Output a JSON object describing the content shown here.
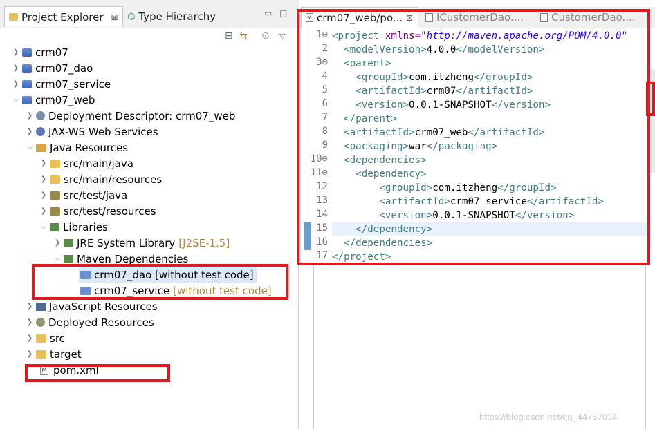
{
  "left_panel": {
    "tabs": [
      {
        "label": "Project Explorer",
        "close": "⊠"
      },
      {
        "label": "Type Hierarchy"
      }
    ],
    "window_controls": {
      "minimize": "▭",
      "maximize": "□"
    },
    "toolbar": {
      "collapse": "⊟",
      "link": "⇆",
      "filter": "⊙",
      "menu": "▽"
    }
  },
  "tree": [
    {
      "label": "crm07"
    },
    {
      "label": "crm07_dao"
    },
    {
      "label": "crm07_service"
    },
    {
      "label": "crm07_web"
    },
    {
      "label": "Deployment Descriptor: crm07_web"
    },
    {
      "label": "JAX-WS Web Services"
    },
    {
      "label": "Java Resources"
    },
    {
      "label": "src/main/java"
    },
    {
      "label": "src/main/resources"
    },
    {
      "label": "src/test/java"
    },
    {
      "label": "src/test/resources"
    },
    {
      "label": "Libraries"
    },
    {
      "label": "JRE System Library",
      "suffix": "[J2SE-1.5]"
    },
    {
      "label": "Maven Dependencies"
    },
    {
      "label": "crm07_dao [without test code]"
    },
    {
      "label": "crm07_service",
      "suffix": "[without test code]"
    },
    {
      "label": "JavaScript Resources"
    },
    {
      "label": "Deployed Resources"
    },
    {
      "label": "src"
    },
    {
      "label": "target"
    },
    {
      "label": "pom.xml",
      "icon_text": "M"
    }
  ],
  "editor": {
    "tabs": [
      {
        "label": "crm07_web/po...",
        "close": "⊠",
        "icon_text": "M"
      },
      {
        "label": "ICustomerDao...."
      },
      {
        "label": "CustomerDao...."
      }
    ],
    "line_numbers": [
      "1",
      "2",
      "3",
      "4",
      "5",
      "6",
      "7",
      "8",
      "9",
      "10",
      "11",
      "12",
      "13",
      "14",
      "15",
      "16",
      "17"
    ],
    "fold_markers": {
      "1": "⊖",
      "3": "⊖",
      "10": "⊖",
      "11": "⊖"
    },
    "lines": [
      [
        {
          "t": "<project ",
          "c": "tg"
        },
        {
          "t": "xmlns=",
          "c": "at"
        },
        {
          "t": "\"http://maven.apache.org/POM/4.0.0\"",
          "c": "av"
        }
      ],
      [
        {
          "t": "  <modelVersion>",
          "c": "tg"
        },
        {
          "t": "4.0.0",
          "c": "tx"
        },
        {
          "t": "</modelVersion>",
          "c": "tg"
        }
      ],
      [
        {
          "t": "  <parent>",
          "c": "tg"
        }
      ],
      [
        {
          "t": "    <groupId>",
          "c": "tg"
        },
        {
          "t": "com.itzheng",
          "c": "tx"
        },
        {
          "t": "</groupId>",
          "c": "tg"
        }
      ],
      [
        {
          "t": "    <artifactId>",
          "c": "tg"
        },
        {
          "t": "crm07",
          "c": "tx"
        },
        {
          "t": "</artifactId>",
          "c": "tg"
        }
      ],
      [
        {
          "t": "    <version>",
          "c": "tg"
        },
        {
          "t": "0.0.1-SNAPSHOT",
          "c": "tx"
        },
        {
          "t": "</version>",
          "c": "tg"
        }
      ],
      [
        {
          "t": "  </parent>",
          "c": "tg"
        }
      ],
      [
        {
          "t": "  <artifactId>",
          "c": "tg"
        },
        {
          "t": "crm07_web",
          "c": "tx"
        },
        {
          "t": "</artifactId>",
          "c": "tg"
        }
      ],
      [
        {
          "t": "  <packaging>",
          "c": "tg"
        },
        {
          "t": "war",
          "c": "tx"
        },
        {
          "t": "</packaging>",
          "c": "tg"
        }
      ],
      [
        {
          "t": "  <dependencies>",
          "c": "tg"
        }
      ],
      [
        {
          "t": "    <dependency>",
          "c": "tg"
        }
      ],
      [
        {
          "t": "        <groupId>",
          "c": "tg"
        },
        {
          "t": "com.itzheng",
          "c": "tx"
        },
        {
          "t": "</groupId>",
          "c": "tg"
        }
      ],
      [
        {
          "t": "        <artifactId>",
          "c": "tg"
        },
        {
          "t": "crm07_service",
          "c": "tx"
        },
        {
          "t": "</artifactId>",
          "c": "tg"
        }
      ],
      [
        {
          "t": "        <version>",
          "c": "tg"
        },
        {
          "t": "0.0.1-SNAPSHOT",
          "c": "tx"
        },
        {
          "t": "</version>",
          "c": "tg"
        }
      ],
      [
        {
          "t": "    </dependency>",
          "c": "tg"
        }
      ],
      [
        {
          "t": "  </dependencies>",
          "c": "tg"
        }
      ],
      [
        {
          "t": "</project>",
          "c": "tg"
        }
      ]
    ]
  },
  "watermark": "https://blog.csdn.net/qq_44757034",
  "colors": {
    "highlight_box": "#e0181f",
    "tag": "#3f7f7f",
    "attr_name": "#7f007f",
    "attr_value": "#2a00ff"
  }
}
